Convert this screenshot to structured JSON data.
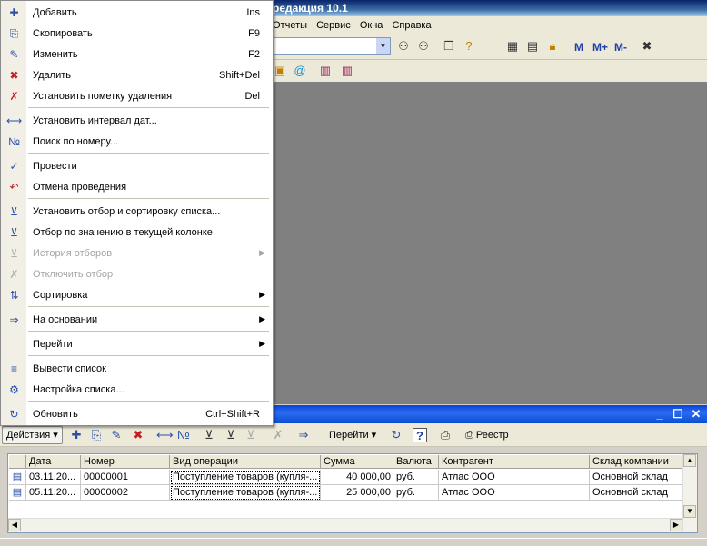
{
  "window": {
    "title": "редакция 10.1"
  },
  "menubar": [
    "Отчеты",
    "Сервис",
    "Окна",
    "Справка"
  ],
  "toolbar": {
    "mlabels": [
      "M",
      "M+",
      "M-"
    ]
  },
  "context_menu": {
    "items": [
      {
        "icon": "add-doc-icon",
        "label": "Добавить",
        "shortcut": "Ins",
        "disabled": false,
        "submenu": false
      },
      {
        "icon": "copy-doc-icon",
        "label": "Скопировать",
        "shortcut": "F9",
        "disabled": false,
        "submenu": false
      },
      {
        "icon": "edit-doc-icon",
        "label": "Изменить",
        "shortcut": "F2",
        "disabled": false,
        "submenu": false
      },
      {
        "icon": "delete-doc-icon",
        "label": "Удалить",
        "shortcut": "Shift+Del",
        "disabled": false,
        "submenu": false
      },
      {
        "icon": "mark-delete-icon",
        "label": "Установить пометку удаления",
        "shortcut": "Del",
        "disabled": false,
        "submenu": false
      },
      {
        "icon": "date-interval-icon",
        "label": "Установить интервал дат...",
        "shortcut": "",
        "disabled": false,
        "submenu": false
      },
      {
        "icon": "search-number-icon",
        "label": "Поиск по номеру...",
        "shortcut": "",
        "disabled": false,
        "submenu": false
      },
      {
        "icon": "post-doc-icon",
        "label": "Провести",
        "shortcut": "",
        "disabled": false,
        "submenu": false
      },
      {
        "icon": "unpost-doc-icon",
        "label": "Отмена проведения",
        "shortcut": "",
        "disabled": false,
        "submenu": false
      },
      {
        "icon": "filter-sort-icon",
        "label": "Установить отбор и сортировку списка...",
        "shortcut": "",
        "disabled": false,
        "submenu": false
      },
      {
        "icon": "filter-column-icon",
        "label": "Отбор по значению в текущей колонке",
        "shortcut": "",
        "disabled": false,
        "submenu": false
      },
      {
        "icon": "filter-history-icon",
        "label": "История отборов",
        "shortcut": "",
        "disabled": true,
        "submenu": true
      },
      {
        "icon": "filter-off-icon",
        "label": "Отключить отбор",
        "shortcut": "",
        "disabled": true,
        "submenu": false
      },
      {
        "icon": "sort-icon",
        "label": "Сортировка",
        "shortcut": "",
        "disabled": false,
        "submenu": true
      },
      {
        "icon": "based-on-icon",
        "label": "На основании",
        "shortcut": "",
        "disabled": false,
        "submenu": true
      },
      {
        "icon": "",
        "label": "Перейти",
        "shortcut": "",
        "disabled": false,
        "submenu": true
      },
      {
        "icon": "list-output-icon",
        "label": "Вывести список",
        "shortcut": "",
        "disabled": false,
        "submenu": false
      },
      {
        "icon": "list-settings-icon",
        "label": "Настройка списка...",
        "shortcut": "",
        "disabled": false,
        "submenu": false
      },
      {
        "icon": "refresh-icon",
        "label": "Обновить",
        "shortcut": "Ctrl+Shift+R",
        "disabled": false,
        "submenu": false
      }
    ]
  },
  "child_toolbar": {
    "actions": "Действия",
    "goto": "Перейти",
    "registry": "Реестр"
  },
  "table": {
    "columns": [
      "Дата",
      "Номер",
      "Вид операции",
      "Сумма",
      "Валюта",
      "Контрагент",
      "Склад компании"
    ],
    "rows": [
      [
        "03.11.20...",
        "00000001",
        "Поступление товаров (купля-...",
        "40 000,00",
        "руб.",
        "Атлас ООО",
        "Основной склад"
      ],
      [
        "05.11.20...",
        "00000002",
        "Поступление товаров (купля-...",
        "25 000,00",
        "руб.",
        "Атлас ООО",
        "Основной склад"
      ]
    ]
  }
}
